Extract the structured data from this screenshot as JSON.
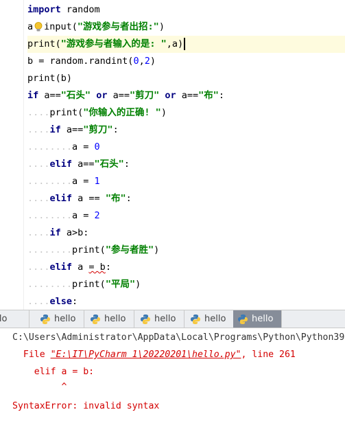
{
  "editor": {
    "lines": [
      {
        "id": "l1",
        "tokens": [
          {
            "t": "import",
            "c": "kw"
          },
          {
            "t": " random",
            "c": ""
          }
        ]
      },
      {
        "id": "l2",
        "tokens": [
          {
            "t": "a",
            "c": ""
          },
          {
            "t": "BULB",
            "c": "icon"
          },
          {
            "t": "input(",
            "c": ""
          },
          {
            "t": "\"游戏参与者出招:\"",
            "c": "str"
          },
          {
            "t": ")",
            "c": ""
          }
        ]
      },
      {
        "id": "l3",
        "tokens": [
          {
            "t": "print(",
            "c": ""
          },
          {
            "t": "\"游戏参与者输入的是: \"",
            "c": "str"
          },
          {
            "t": ",a)",
            "c": ""
          },
          {
            "t": "CURSOR",
            "c": "cursor"
          }
        ]
      },
      {
        "id": "l4",
        "tokens": [
          {
            "t": "b = random.randint(",
            "c": ""
          },
          {
            "t": "0",
            "c": "num"
          },
          {
            "t": ",",
            "c": ""
          },
          {
            "t": "2",
            "c": "num"
          },
          {
            "t": ")",
            "c": ""
          }
        ]
      },
      {
        "id": "l5",
        "tokens": [
          {
            "t": "print(b)",
            "c": ""
          }
        ]
      },
      {
        "id": "l6",
        "tokens": [
          {
            "t": "if",
            "c": "kw"
          },
          {
            "t": " a==",
            "c": ""
          },
          {
            "t": "\"石头\"",
            "c": "str"
          },
          {
            "t": " ",
            "c": ""
          },
          {
            "t": "or",
            "c": "kw"
          },
          {
            "t": " a==",
            "c": ""
          },
          {
            "t": "\"剪刀\"",
            "c": "str"
          },
          {
            "t": " ",
            "c": ""
          },
          {
            "t": "or",
            "c": "kw"
          },
          {
            "t": " a==",
            "c": ""
          },
          {
            "t": "\"布\"",
            "c": "str"
          },
          {
            "t": ":",
            "c": ""
          }
        ]
      },
      {
        "id": "l7",
        "tokens": [
          {
            "t": "....",
            "c": "ws"
          },
          {
            "t": "print(",
            "c": ""
          },
          {
            "t": "\"你输入的正确! \"",
            "c": "str"
          },
          {
            "t": ")",
            "c": ""
          }
        ]
      },
      {
        "id": "l8",
        "tokens": [
          {
            "t": "....",
            "c": "ws"
          },
          {
            "t": "if",
            "c": "kw"
          },
          {
            "t": " a==",
            "c": ""
          },
          {
            "t": "\"剪刀\"",
            "c": "str"
          },
          {
            "t": ":",
            "c": ""
          }
        ]
      },
      {
        "id": "l9",
        "tokens": [
          {
            "t": "........",
            "c": "ws"
          },
          {
            "t": "a = ",
            "c": ""
          },
          {
            "t": "0",
            "c": "num"
          }
        ]
      },
      {
        "id": "l10",
        "tokens": [
          {
            "t": "....",
            "c": "ws"
          },
          {
            "t": "elif",
            "c": "kw"
          },
          {
            "t": " a==",
            "c": ""
          },
          {
            "t": "\"石头\"",
            "c": "str"
          },
          {
            "t": ":",
            "c": ""
          }
        ]
      },
      {
        "id": "l11",
        "tokens": [
          {
            "t": "........",
            "c": "ws"
          },
          {
            "t": "a = ",
            "c": ""
          },
          {
            "t": "1",
            "c": "num"
          }
        ]
      },
      {
        "id": "l12",
        "tokens": [
          {
            "t": "....",
            "c": "ws"
          },
          {
            "t": "elif",
            "c": "kw"
          },
          {
            "t": " a == ",
            "c": ""
          },
          {
            "t": "\"布\"",
            "c": "str"
          },
          {
            "t": ":",
            "c": ""
          }
        ]
      },
      {
        "id": "l13",
        "tokens": [
          {
            "t": "........",
            "c": "ws"
          },
          {
            "t": "a = ",
            "c": ""
          },
          {
            "t": "2",
            "c": "num"
          }
        ]
      },
      {
        "id": "l14",
        "tokens": [
          {
            "t": "....",
            "c": "ws"
          },
          {
            "t": "if",
            "c": "kw"
          },
          {
            "t": " a>b:",
            "c": ""
          }
        ]
      },
      {
        "id": "l15",
        "tokens": [
          {
            "t": "........",
            "c": "ws"
          },
          {
            "t": "print(",
            "c": ""
          },
          {
            "t": "\"参与者胜\"",
            "c": "str"
          },
          {
            "t": ")",
            "c": ""
          }
        ]
      },
      {
        "id": "l16",
        "tokens": [
          {
            "t": "....",
            "c": "ws"
          },
          {
            "t": "elif",
            "c": "kw"
          },
          {
            "t": " a ",
            "c": ""
          },
          {
            "t": "= b",
            "c": "squiggle"
          },
          {
            "t": ":",
            "c": ""
          }
        ]
      },
      {
        "id": "l17",
        "tokens": [
          {
            "t": "........",
            "c": "ws"
          },
          {
            "t": "print(",
            "c": ""
          },
          {
            "t": "\"平局\"",
            "c": "str"
          },
          {
            "t": ")",
            "c": ""
          }
        ]
      },
      {
        "id": "l18",
        "tokens": [
          {
            "t": "....",
            "c": "ws"
          },
          {
            "t": "else",
            "c": "kw"
          },
          {
            "t": ":",
            "c": ""
          }
        ]
      }
    ]
  },
  "run_tabs": [
    {
      "label": "hello",
      "icon": "python-icon",
      "active": false
    },
    {
      "label": "hello",
      "icon": "python-icon",
      "active": false
    },
    {
      "label": "hello",
      "icon": "python-icon",
      "active": false
    },
    {
      "label": "hello",
      "icon": "python-icon",
      "active": false
    },
    {
      "label": "hello",
      "icon": "python-icon",
      "active": false
    },
    {
      "label": "hello",
      "icon": "python-icon",
      "active": true
    }
  ],
  "console": {
    "command": "C:\\Users\\Administrator\\AppData\\Local\\Programs\\Python\\Python39",
    "file_prefix": "  File ",
    "file_link": "\"E:\\IT\\PyCharm 1\\20220201\\hello.py\"",
    "file_suffix": ", line 261",
    "code_line": "    elif a = b:",
    "caret": "         ^",
    "error": "SyntaxError: invalid syntax"
  },
  "colors": {
    "keyword": "#000080",
    "string": "#008000",
    "number": "#0000ff",
    "error": "#d40000",
    "current_line": "#fefbde",
    "active_tab": "#868d99"
  }
}
